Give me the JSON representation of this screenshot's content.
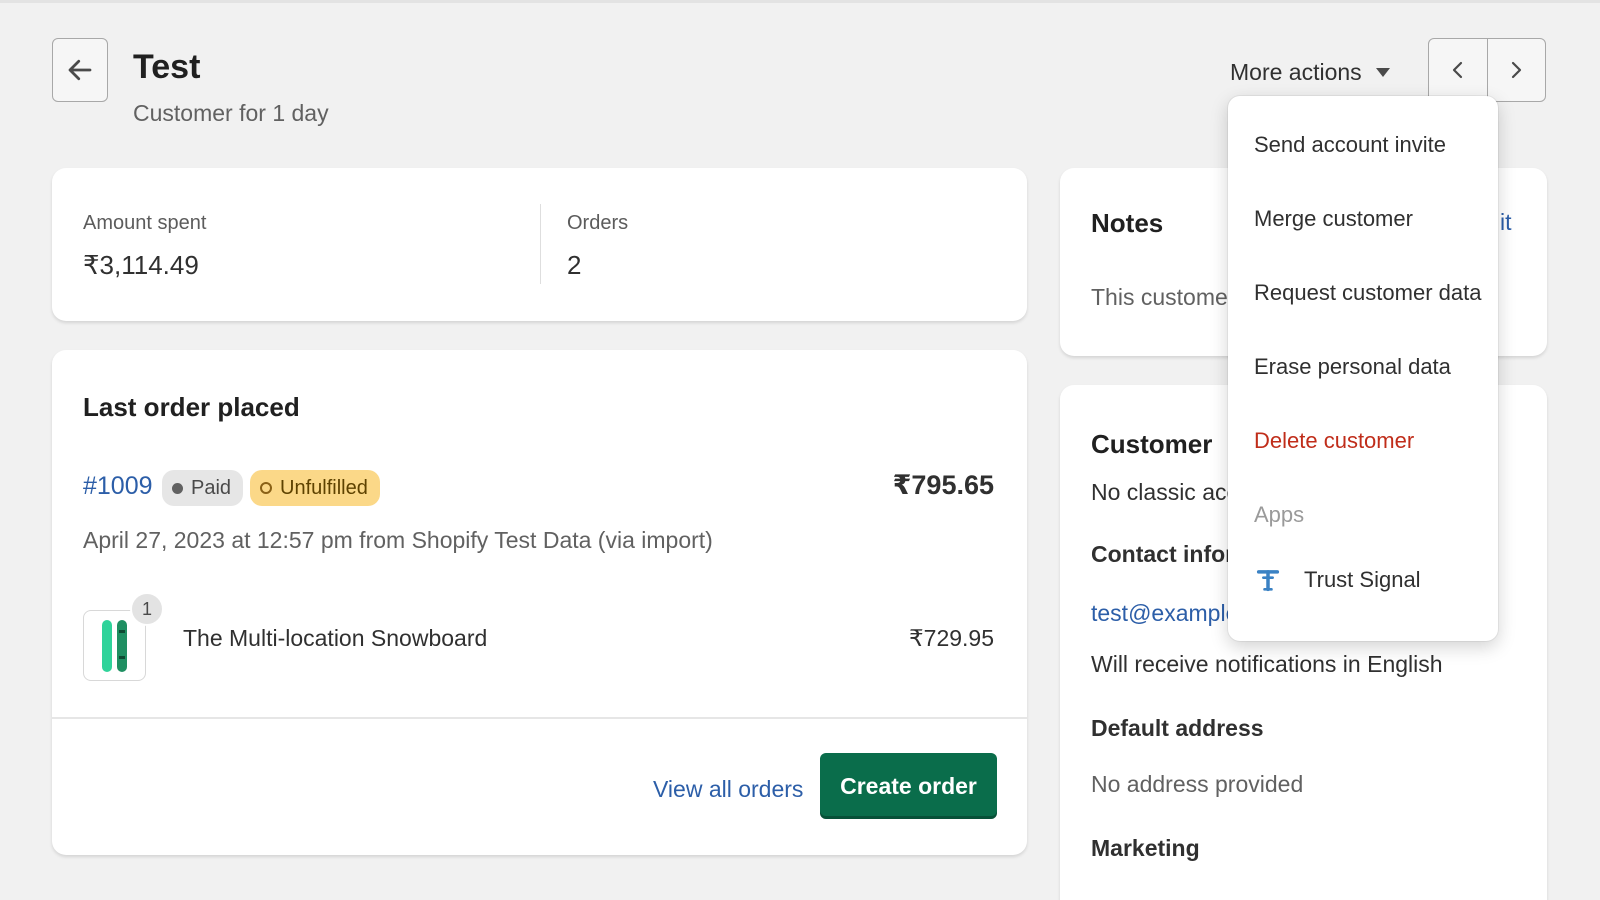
{
  "header": {
    "title": "Test",
    "subtitle": "Customer for 1 day",
    "more_actions_label": "More actions"
  },
  "stats": {
    "amount_label": "Amount spent",
    "amount_value": "₹3,114.49",
    "orders_label": "Orders",
    "orders_value": "2"
  },
  "last_order": {
    "title": "Last order placed",
    "order_number": "#1009",
    "payment_status": "Paid",
    "fulfillment_status": "Unfulfilled",
    "total": "₹795.65",
    "meta": "April 27, 2023 at 12:57 pm from Shopify Test Data (via import)",
    "item": {
      "quantity": "1",
      "name": "The Multi-location Snowboard",
      "price": "₹729.95"
    },
    "view_all_label": "View all orders",
    "create_order_label": "Create order"
  },
  "notes": {
    "title": "Notes",
    "edit_label_visible": "it",
    "text_visible": "This customer"
  },
  "customer": {
    "title": "Customer",
    "account_text_visible": "No classic acc",
    "contact_title_visible": "Contact infor",
    "email_visible": "test@example",
    "notifications": "Will receive notifications in English",
    "default_address_title": "Default address",
    "address_text": "No address provided",
    "marketing_title": "Marketing"
  },
  "more_actions_menu": {
    "items": [
      {
        "label": "Send account invite",
        "tone": "default"
      },
      {
        "label": "Merge customer",
        "tone": "default"
      },
      {
        "label": "Request customer data",
        "tone": "default"
      },
      {
        "label": "Erase personal data",
        "tone": "default"
      },
      {
        "label": "Delete customer",
        "tone": "critical"
      }
    ],
    "apps_section_label": "Apps",
    "apps": [
      {
        "label": "Trust Signal",
        "icon": "trust-signal-icon"
      }
    ]
  },
  "colors": {
    "background": "#f1f1f1",
    "link": "#2c5ea8",
    "primary_button": "#0a6d4b",
    "critical": "#c02d1a",
    "badge_attention": "#fbd888",
    "trust_signal": "#3b82c4"
  }
}
